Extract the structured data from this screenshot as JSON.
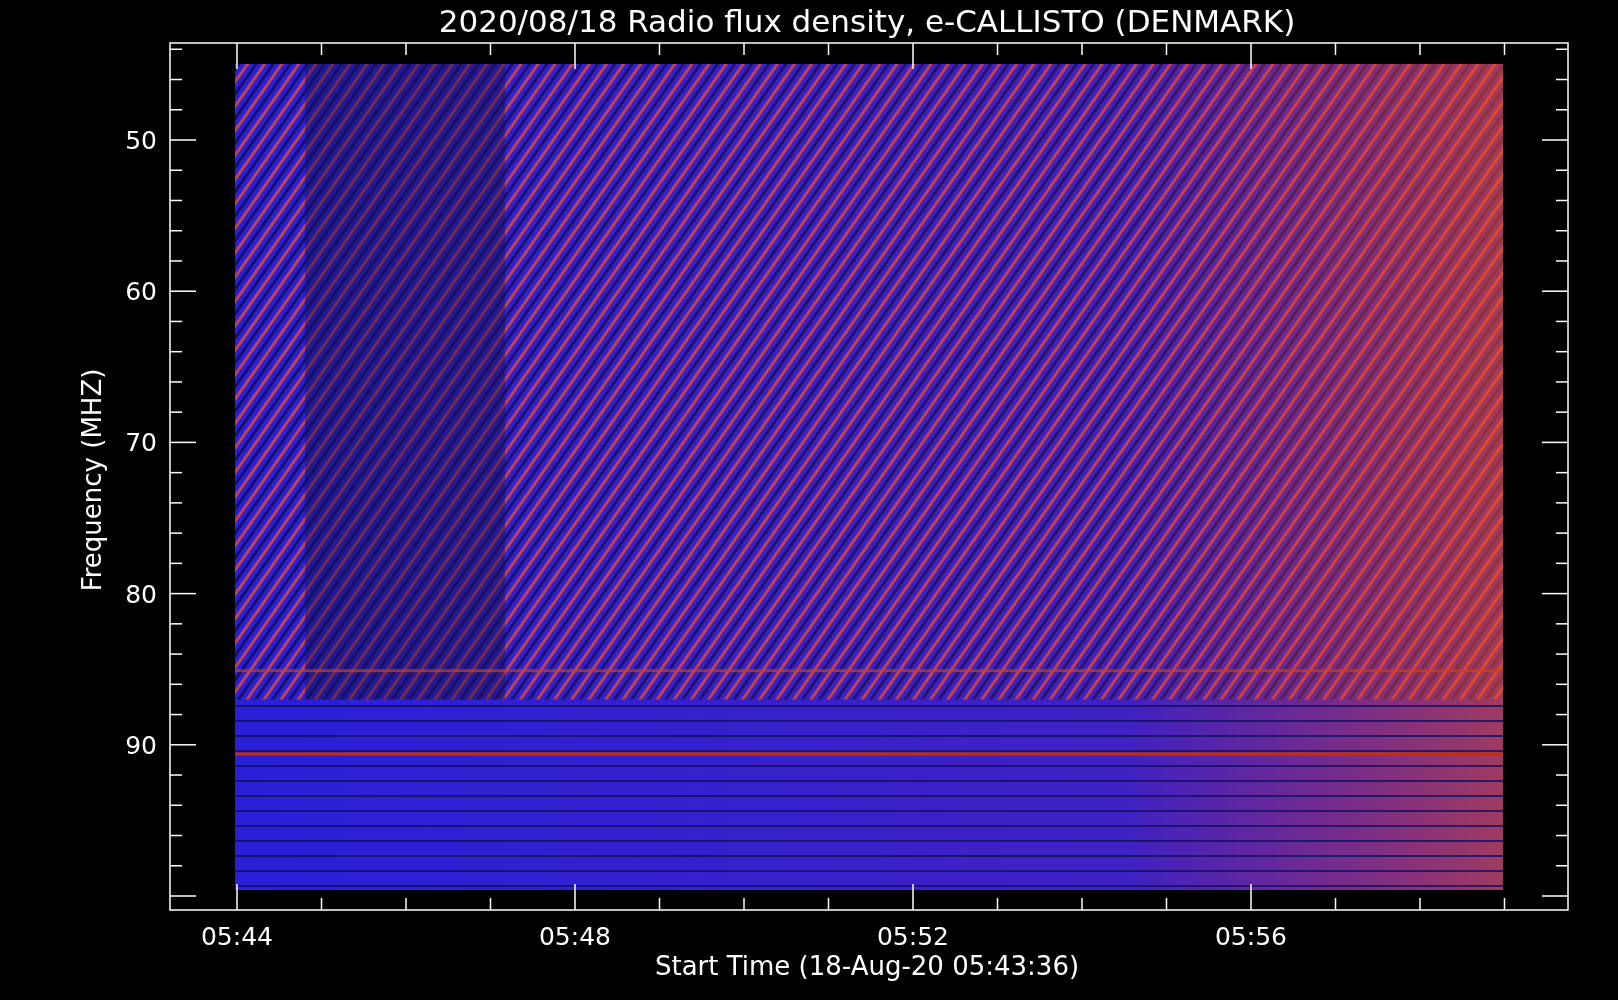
{
  "plot": {
    "title": "2020/08/18  Radio flux density, e-CALLISTO (DENMARK)",
    "ylabel": "Frequency (MHZ)",
    "xlabel": "Start Time (18-Aug-20 05:43:36)",
    "y_tick_labels": [
      "50",
      "60",
      "70",
      "80",
      "90"
    ],
    "x_tick_labels": [
      "05:44",
      "05:48",
      "05:52",
      "05:56"
    ]
  }
}
